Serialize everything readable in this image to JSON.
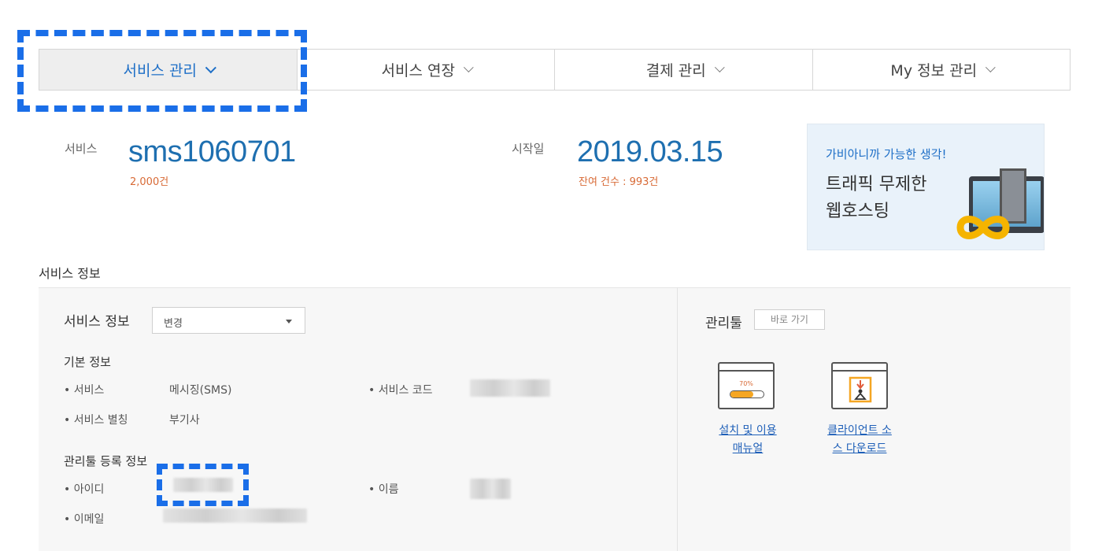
{
  "nav": {
    "tabs": [
      {
        "label": "서비스 관리"
      },
      {
        "label": "서비스 연장"
      },
      {
        "label": "결제 관리"
      },
      {
        "label": "My 정보 관리"
      }
    ]
  },
  "summary": {
    "service_label": "서비스",
    "service_value": "sms1060701",
    "service_sub": "2,000건",
    "start_label": "시작일",
    "start_value": "2019.03.15",
    "start_sub": "잔여 건수 : 993건"
  },
  "banner": {
    "line1": "가비아니까 가능한 생각!",
    "line2": "트래픽 무제한",
    "line3": "웹호스팅"
  },
  "section_title": "서비스 정보",
  "info": {
    "title": "서비스 정보",
    "select_value": "변경",
    "basic_title": "기본 정보",
    "service_key": "• 서비스",
    "service_val": "메시징(SMS)",
    "code_key": "• 서비스 코드",
    "alias_key": "• 서비스 별칭",
    "alias_val": "부기사",
    "admin_title": "관리툴 등록 정보",
    "id_key": "• 아이디",
    "name_key": "• 이름",
    "email_key": "• 이메일"
  },
  "tools": {
    "title": "관리툴",
    "goto_label": "바로 가기",
    "items": [
      {
        "line1": "설치 및 이용",
        "line2": "매뉴얼",
        "icon": "progress-window-icon",
        "percent_text": "70%"
      },
      {
        "line1": "클라이언트 소",
        "line2": "스 다운로드",
        "icon": "download-window-icon"
      }
    ]
  },
  "colors": {
    "accent": "#1e6fc7",
    "highlight": "#1a6ee8",
    "orange": "#d86a36"
  }
}
